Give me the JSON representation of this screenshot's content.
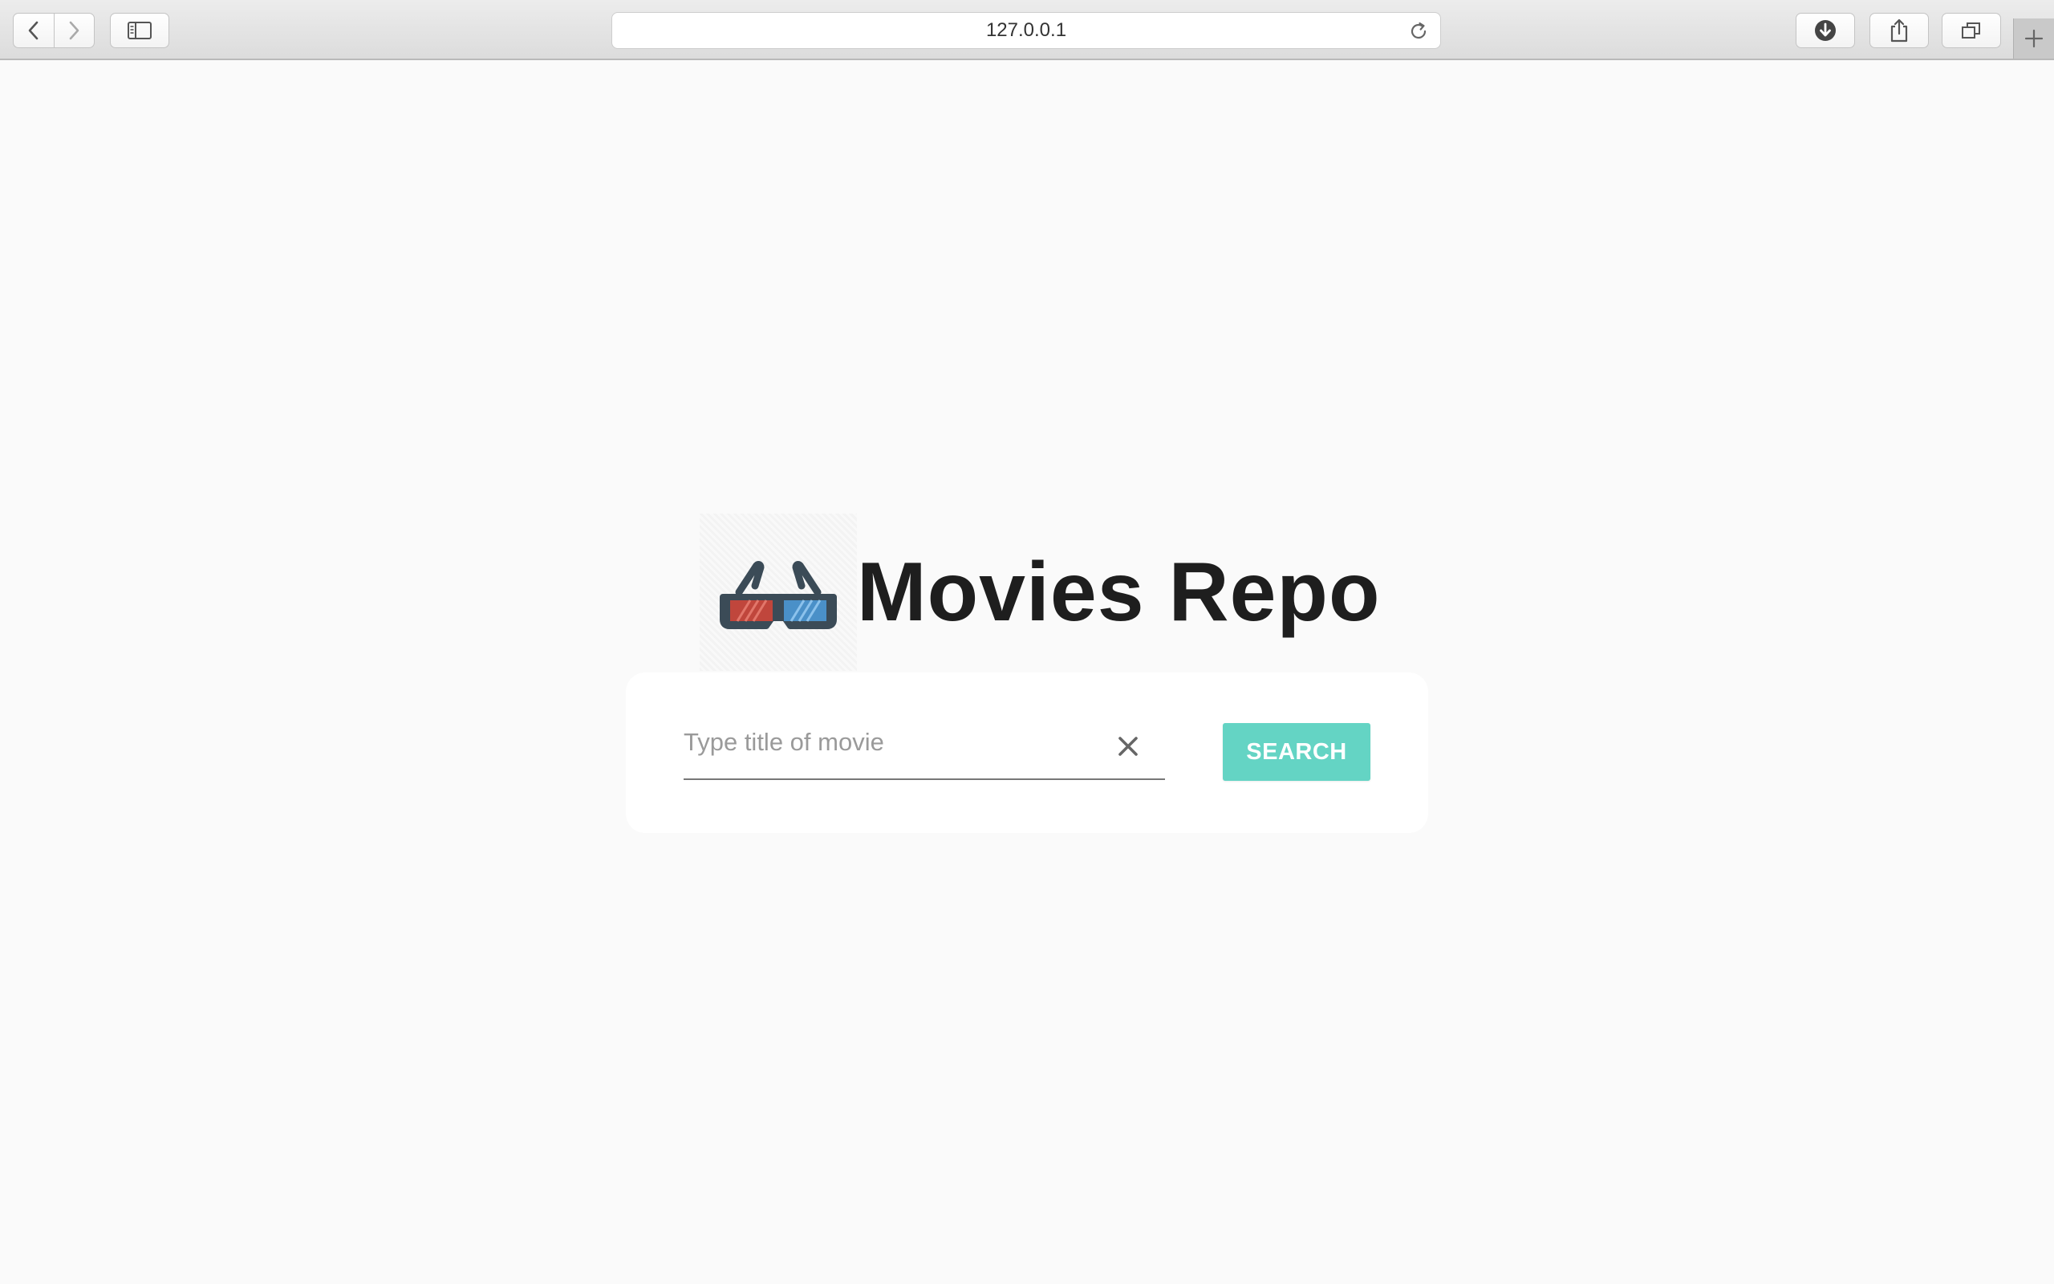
{
  "browser": {
    "address": "127.0.0.1",
    "icons": {
      "back": "chevron-left-icon",
      "forward": "chevron-right-icon",
      "sidebar": "sidebar-icon",
      "reload": "reload-icon",
      "downloads": "download-icon",
      "share": "share-icon",
      "tabs": "tab-overview-icon",
      "new_tab": "plus-icon"
    }
  },
  "app": {
    "logo_icon": "3d-glasses-icon",
    "title": "Movies Repo"
  },
  "search": {
    "placeholder": "Type title of movie",
    "value": "",
    "clear_icon": "close-icon",
    "button_label": "SEARCH",
    "button_color": "#64d4c4"
  }
}
